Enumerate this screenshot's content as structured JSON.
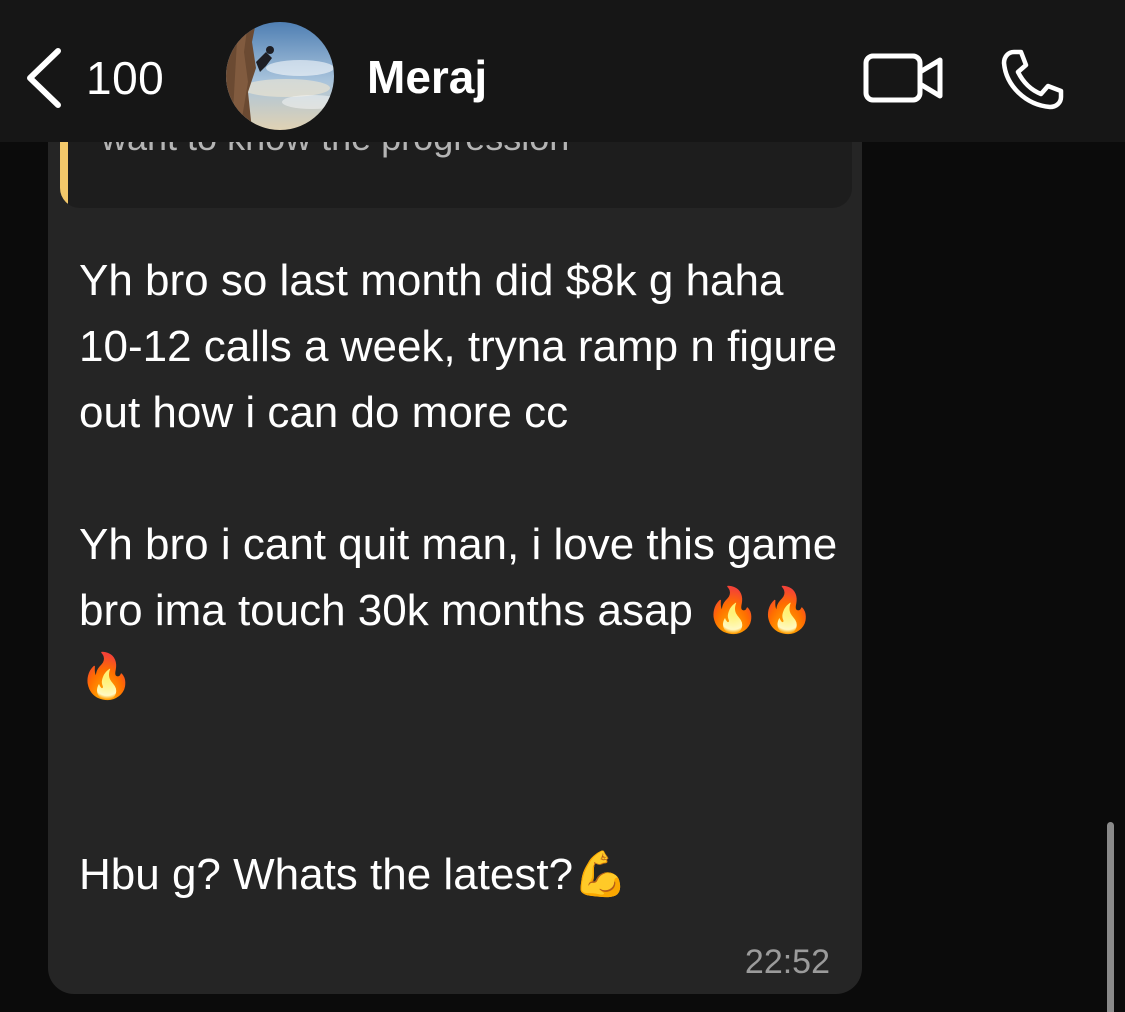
{
  "header": {
    "back_count": "100",
    "contact_name": "Meraj",
    "icons": {
      "back": "chevron-left-icon",
      "video": "video-camera-icon",
      "call": "phone-icon"
    }
  },
  "message": {
    "quoted_text": "want to know the progression",
    "paragraphs": [
      "Yh bro so last month did $8k g haha 10-12 calls a week, tryna ramp n figure out how i can do more cc",
      "Yh bro i cant quit man, i love this game bro ima touch 30k months asap 🔥🔥🔥",
      "Hbu g? Whats the latest?💪"
    ],
    "time": "22:52"
  },
  "colors": {
    "header_bg": "#161616",
    "chat_bg": "#0b0b0b",
    "bubble_bg": "#252525",
    "quote_accent": "#f3c86a",
    "timestamp": "#9b9b9b"
  }
}
